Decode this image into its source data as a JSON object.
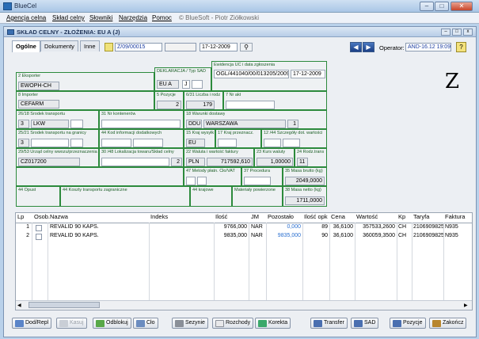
{
  "app": {
    "title": "BlueCel"
  },
  "menu": {
    "items": [
      "Agencja celna",
      "Skład celny",
      "Słowniki",
      "Narzędzia",
      "Pomoc"
    ],
    "copyright": "© BlueSoft - Piotr Ziółkowski"
  },
  "window": {
    "title": "SKŁAD CELNY - ZŁOŻENIA: EU A  (J)"
  },
  "tabs": [
    "Ogólne",
    "Dokumenty",
    "Inne"
  ],
  "header": {
    "doc_number": "Z/09/00015",
    "doc_date": "17-12-2009",
    "operator_label": "Operator:",
    "operator_value": "AND-16.12 19:09"
  },
  "form": {
    "eksporter_label": "2 Eksporter",
    "eksporter": "EWOPH-CH",
    "importer_label": "8 Importer",
    "importer": "CEFARM",
    "deklaracja_label": "DEKLARACJA / Typ SAD",
    "deklaracja_1": "EU A",
    "deklaracja_2": "J",
    "ewidencja_label": "Ewidencja UC i data zgłoszenia",
    "ewidencja_nr": "OGL/441040/00/013205/2009",
    "ewidencja_data": "17-12-2009",
    "pozycje_label": "5 Pozycje",
    "pozycje": "2",
    "liczba_label": "6/31 Liczba i rodz",
    "liczba": "179",
    "nrakt_label": "7 Nr akt",
    "nrakt": "",
    "srodek_label": "26/18 Środek transportu",
    "srodek_1": "3",
    "srodek_2": "LKW",
    "kontener_label": "31 Nr kontenerów",
    "kontener": "",
    "warunki_label": "18 Warunki dostawy",
    "warunki_1": "DDU",
    "warunki_2": "WARSZAWA",
    "warunki_3": "1",
    "granica_label": "25/21 Środek transportu na granicy",
    "granica_1": "3",
    "granica_2": "",
    "kod_label": "44 Kod informacji dodatkowych",
    "kod": "",
    "kraj_label": "15 Kraj wysyłk",
    "kraj": "EU",
    "przeznacz_label": "17 Kraj przeznacz.",
    "przeznacz": "",
    "szczegoly_label": "12 /44 Szczegóły dot. wartości",
    "szczegoly": "",
    "urzad_label": "29/53 Urząd celny wwozu/przeznaczenia",
    "urzad": "CZ017200",
    "lokalizacja_label": "30 /48 Lokalizacja towaru/Skład celny",
    "lokalizacja": "2",
    "waluta_label": "22 Waluta i wartość faktury",
    "waluta": "PLN",
    "wartosc": "717592,610",
    "kurs_label": "23 Kurs waluty",
    "kurs": "1,00000",
    "rodz_label": "24 Rodz.trans",
    "rodz": "11",
    "metody_label": "47 Metody płatn. Cło/VAT",
    "metody_1": "",
    "metody_2": "",
    "procedura_label": "37 Procedura",
    "procedura": "",
    "brutto_label": "35 Masa brutto (kg)",
    "brutto": "2049,0000",
    "opust_label": "44 Opust",
    "koszty_label": "44 Koszty transportu zagraniczne",
    "krajowe_label": "44 krajowe",
    "materialy_label": "Materiały powierzone",
    "netto_label": "38 Masa netto (kg)",
    "netto": "1711,0000"
  },
  "table": {
    "columns": [
      "Lp",
      "Osob.",
      "Nazwa",
      "Indeks",
      "Ilość",
      "JM",
      "Pozostało",
      "Ilość opk",
      "Cena",
      "Wartość",
      "Kp",
      "Taryfa",
      "Faktura"
    ],
    "rows": [
      [
        "1",
        "",
        "REVALID 90 KAPS.",
        "",
        "9766,000",
        "NAR",
        "0,000",
        "89",
        "36,6100",
        "357533,2600",
        "CH",
        "2106909825",
        "N935"
      ],
      [
        "2",
        "",
        "REVALID 90 KAPS.",
        "",
        "9835,000",
        "NAR",
        "9835,000",
        "90",
        "36,6100",
        "360059,3500",
        "CH",
        "2106909825",
        "N935"
      ]
    ]
  },
  "buttons": [
    "Dod/Repl",
    "Kasuj",
    "Odblokuj",
    "Cło",
    "Sezynie",
    "Rozchody",
    "Korekta",
    "Transfer",
    "SAD",
    "Pozycje",
    "Zakończ"
  ],
  "colors": {
    "form_border": "#2c8a3c",
    "accent_blue": "#1a3ca0",
    "remaining_blue": "#2a6fd0"
  }
}
